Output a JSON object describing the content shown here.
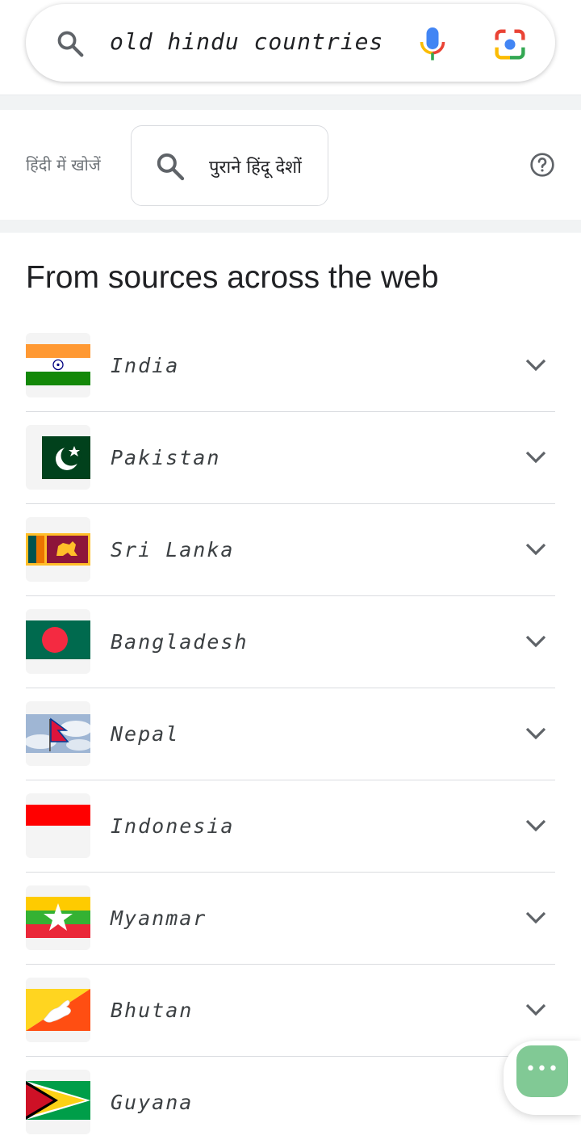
{
  "search": {
    "query": "old hindu countries",
    "icons": {
      "search": "search-icon",
      "voice": "mic-icon",
      "lens": "camera-lens-icon"
    }
  },
  "hindi": {
    "label": "हिंदी में खोजें",
    "chip_text": "पुराने हिंदू देशों",
    "help_icon": "help-icon"
  },
  "results": {
    "title": "From sources across the web",
    "items": [
      {
        "name": "India",
        "flag": "india-flag"
      },
      {
        "name": "Pakistan",
        "flag": "pakistan-flag"
      },
      {
        "name": "Sri Lanka",
        "flag": "sri-lanka-flag"
      },
      {
        "name": "Bangladesh",
        "flag": "bangladesh-flag"
      },
      {
        "name": "Nepal",
        "flag": "nepal-flag"
      },
      {
        "name": "Indonesia",
        "flag": "indonesia-flag"
      },
      {
        "name": "Myanmar",
        "flag": "myanmar-flag"
      },
      {
        "name": "Bhutan",
        "flag": "bhutan-flag"
      },
      {
        "name": "Guyana",
        "flag": "guyana-flag"
      }
    ]
  },
  "fab": {
    "label": "•••",
    "color": "#81c995"
  },
  "colors": {
    "blue": "#4285f4",
    "red": "#ea4335",
    "yellow": "#fbbc04",
    "green": "#34a853",
    "divider": "#dadce0"
  }
}
